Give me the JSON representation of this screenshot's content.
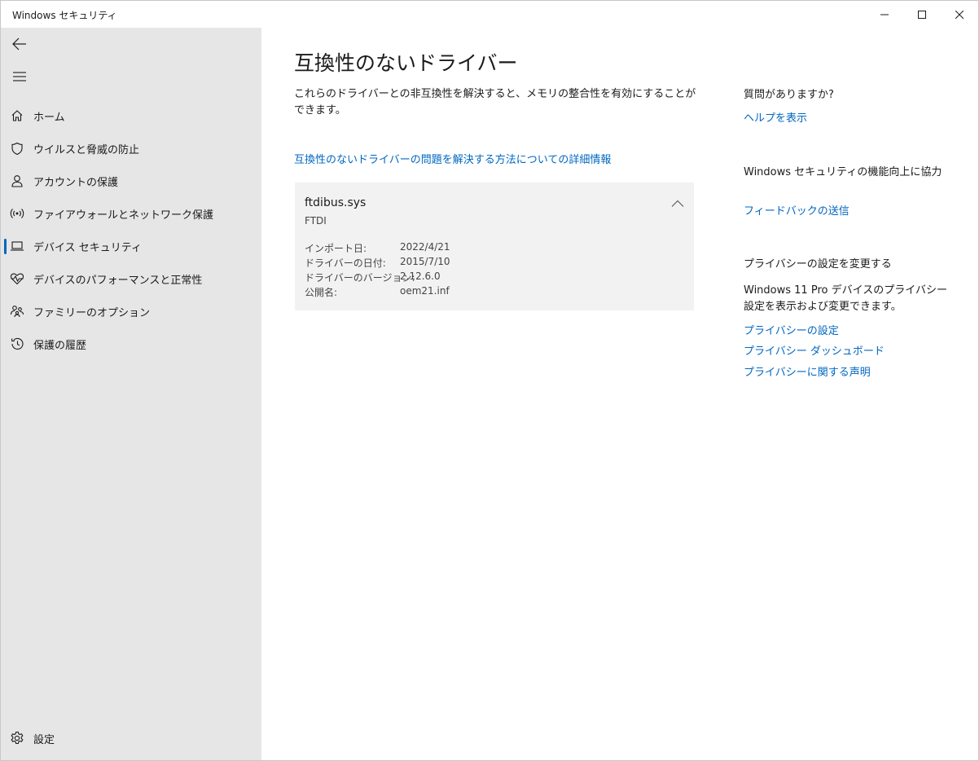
{
  "window": {
    "title": "Windows セキュリティ"
  },
  "sidebar": {
    "items": [
      {
        "label": "ホーム",
        "icon": "home-icon"
      },
      {
        "label": "ウイルスと脅威の防止",
        "icon": "shield-icon"
      },
      {
        "label": "アカウントの保護",
        "icon": "person-icon"
      },
      {
        "label": "ファイアウォールとネットワーク保護",
        "icon": "wireless-icon"
      },
      {
        "label": "デバイス セキュリティ",
        "icon": "laptop-icon",
        "active": true
      },
      {
        "label": "デバイスのパフォーマンスと正常性",
        "icon": "heart-pulse-icon"
      },
      {
        "label": "ファミリーのオプション",
        "icon": "family-icon"
      },
      {
        "label": "保護の履歴",
        "icon": "history-icon"
      }
    ],
    "settings_label": "設定"
  },
  "main": {
    "title": "互換性のないドライバー",
    "description": "これらのドライバーとの非互換性を解決すると、メモリの整合性を有効にすることができます。",
    "info_link": "互換性のないドライバーの問題を解決する方法についての詳細情報",
    "driver": {
      "name": "ftdibus.sys",
      "vendor": "FTDI",
      "details": [
        {
          "key": "インポート日:",
          "value": "2022/4/21"
        },
        {
          "key": "ドライバーの日付:",
          "value": "2015/7/10"
        },
        {
          "key": "ドライバーのバージョン:",
          "value": "2.12.6.0"
        },
        {
          "key": "公開名:",
          "value": "oem21.inf"
        }
      ]
    }
  },
  "aside": {
    "question_heading": "質問がありますか?",
    "help_link": "ヘルプを表示",
    "improve_heading": "Windows セキュリティの機能向上に協力",
    "feedback_link": "フィードバックの送信",
    "privacy_heading": "プライバシーの設定を変更する",
    "privacy_text": "Windows 11 Pro デバイスのプライバシー設定を表示および変更できます。",
    "privacy_links": [
      "プライバシーの設定",
      "プライバシー ダッシュボード",
      "プライバシーに関する声明"
    ]
  },
  "colors": {
    "accent": "#0067c0",
    "sidebar_bg": "#e6e6e6",
    "card_bg": "#f2f2f2"
  }
}
